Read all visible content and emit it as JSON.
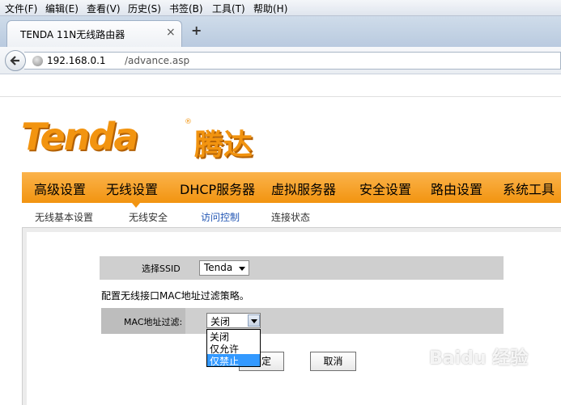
{
  "browser": {
    "menu": [
      "文件(F)",
      "编辑(E)",
      "查看(V)",
      "历史(S)",
      "书签(B)",
      "工具(T)",
      "帮助(H)"
    ],
    "tab_title": "TENDA 11N无线路由器",
    "tab_close": "×",
    "new_tab": "+",
    "address_host": "192.168.0.1",
    "address_path": "/advance.asp"
  },
  "logo": {
    "en": "Tenda",
    "reg": "®",
    "cn": "腾达"
  },
  "main_nav": [
    "高级设置",
    "无线设置",
    "DHCP服务器",
    "虚拟服务器",
    "安全设置",
    "路由设置",
    "系统工具"
  ],
  "sub_nav": [
    "无线基本设置",
    "无线安全",
    "访问控制",
    "连接状态"
  ],
  "form": {
    "ssid_label": "选择SSID",
    "ssid_value": "Tenda",
    "description": "配置无线接口MAC地址过滤策略。",
    "mac_label": "MAC地址过滤:",
    "mac_value": "关闭",
    "mac_options": [
      "关闭",
      "仅允许",
      "仅禁止"
    ],
    "ok_button": "确定",
    "cancel_button": "取消"
  },
  "watermark": "Baidu 经验",
  "colors": {
    "brand_orange": "#f29410",
    "dropdown_highlight": "#3399ff",
    "active_link": "#2357b4"
  }
}
